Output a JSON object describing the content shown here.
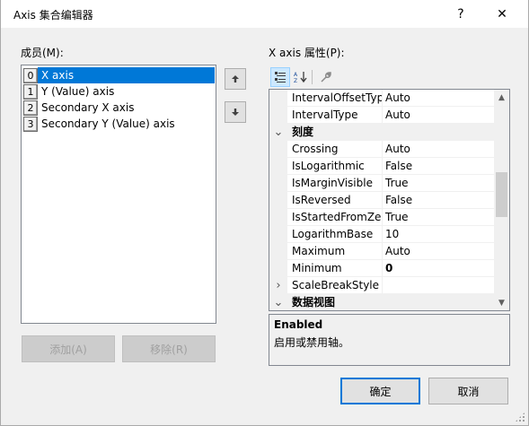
{
  "window": {
    "title": "Axis 集合编辑器",
    "help_glyph": "?",
    "close_glyph": "✕"
  },
  "members": {
    "label": "成员(M):",
    "items": [
      {
        "index": "0",
        "text": "X axis",
        "selected": true
      },
      {
        "index": "1",
        "text": "Y (Value) axis",
        "selected": false
      },
      {
        "index": "2",
        "text": "Secondary X axis",
        "selected": false
      },
      {
        "index": "3",
        "text": "Secondary Y (Value) axis",
        "selected": false
      }
    ],
    "move_up_glyph": "🡅",
    "move_down_glyph": "🡇"
  },
  "properties": {
    "label": "X axis 属性(P):",
    "toolbar": {
      "categorized_icon": "categorized-icon",
      "alphabetical_icon": "alphabetical-icon",
      "property_pages_icon": "wrench-icon"
    },
    "rows": [
      {
        "kind": "prop",
        "name": "IntervalOffsetTyp",
        "value": "Auto"
      },
      {
        "kind": "prop",
        "name": "IntervalType",
        "value": "Auto"
      },
      {
        "kind": "category",
        "name": "刻度",
        "expanded": true
      },
      {
        "kind": "prop",
        "name": "Crossing",
        "value": "Auto"
      },
      {
        "kind": "prop",
        "name": "IsLogarithmic",
        "value": "False"
      },
      {
        "kind": "prop",
        "name": "IsMarginVisible",
        "value": "True"
      },
      {
        "kind": "prop",
        "name": "IsReversed",
        "value": "False"
      },
      {
        "kind": "prop",
        "name": "IsStartedFromZer",
        "value": "True"
      },
      {
        "kind": "prop",
        "name": "LogarithmBase",
        "value": "10"
      },
      {
        "kind": "prop",
        "name": "Maximum",
        "value": "Auto"
      },
      {
        "kind": "prop",
        "name": "Minimum",
        "value": "0",
        "bold": true
      },
      {
        "kind": "expandable",
        "name": "ScaleBreakStyle",
        "value": ""
      },
      {
        "kind": "category",
        "name": "数据视图",
        "expanded": true
      }
    ],
    "description": {
      "title": "Enabled",
      "text": "启用或禁用轴。"
    }
  },
  "buttons": {
    "add": "添加(A)",
    "remove": "移除(R)",
    "ok": "确定",
    "cancel": "取消"
  }
}
